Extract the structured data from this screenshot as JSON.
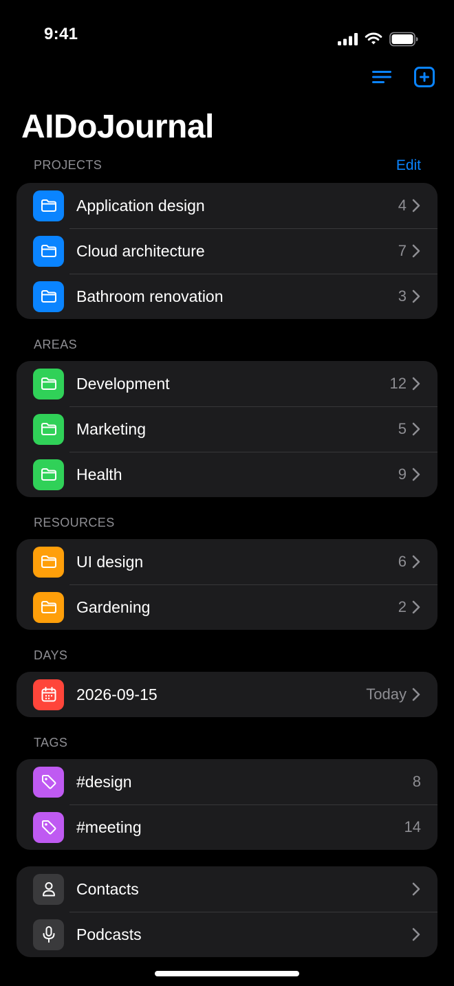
{
  "status_bar": {
    "time": "9:41"
  },
  "title": "AIDoJournal",
  "colors": {
    "accent": "#0a84ff",
    "projects": "#0a84ff",
    "areas": "#30d158",
    "resources": "#ff9f0a",
    "days": "#ff453a",
    "tags": "#bf5af2",
    "misc": "#3a3a3c"
  },
  "projects": {
    "header": "PROJECTS",
    "edit_label": "Edit",
    "items": [
      {
        "label": "Application design",
        "count": "4",
        "icon": "folder-icon"
      },
      {
        "label": "Cloud architecture",
        "count": "7",
        "icon": "folder-icon"
      },
      {
        "label": "Bathroom renovation",
        "count": "3",
        "icon": "folder-icon"
      }
    ]
  },
  "areas": {
    "header": "AREAS",
    "items": [
      {
        "label": "Development",
        "count": "12",
        "icon": "folder-icon"
      },
      {
        "label": "Marketing",
        "count": "5",
        "icon": "folder-icon"
      },
      {
        "label": "Health",
        "count": "9",
        "icon": "folder-icon"
      }
    ]
  },
  "resources": {
    "header": "RESOURCES",
    "items": [
      {
        "label": "UI design",
        "count": "6",
        "icon": "folder-icon"
      },
      {
        "label": "Gardening",
        "count": "2",
        "icon": "folder-icon"
      }
    ]
  },
  "days": {
    "header": "DAYS",
    "items": [
      {
        "label": "2026-09-15",
        "count": "Today",
        "icon": "calendar-icon"
      }
    ]
  },
  "tags": {
    "header": "TAGS",
    "items": [
      {
        "label": "#design",
        "count": "8",
        "icon": "tag-icon"
      },
      {
        "label": "#meeting",
        "count": "14",
        "icon": "tag-icon"
      }
    ]
  },
  "misc": {
    "items": [
      {
        "label": "Contacts",
        "icon": "person-icon"
      },
      {
        "label": "Podcasts",
        "icon": "microphone-icon"
      }
    ]
  },
  "toolbar": {
    "menu_icon": "list-icon",
    "add_icon": "plus-square-icon"
  }
}
